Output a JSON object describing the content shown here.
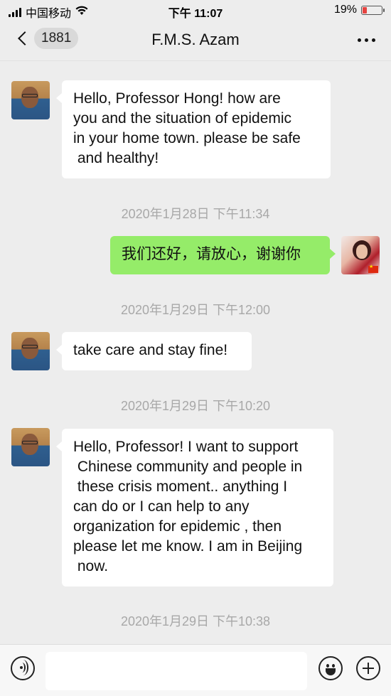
{
  "status_bar": {
    "carrier": "中国移动",
    "time": "下午 11:07",
    "battery_percent": "19%",
    "battery_level": 0.19,
    "battery_color": "#e64340"
  },
  "header": {
    "unread_count": "1881",
    "title": "F.M.S. Azam",
    "more_icon": "more-dots-icon"
  },
  "messages": [
    {
      "direction": "incoming",
      "text": "Hello, Professor Hong! how are\nyou and the situation of epidemic\nin your home town. please be safe\n and healthy!"
    },
    {
      "timestamp": "2020年1月28日 下午11:34"
    },
    {
      "direction": "outgoing",
      "text": "我们还好，请放心，谢谢你"
    },
    {
      "timestamp": "2020年1月29日 下午12:00"
    },
    {
      "direction": "incoming",
      "text": "take care and stay fine!"
    },
    {
      "timestamp": "2020年1月29日 下午10:20"
    },
    {
      "direction": "incoming",
      "text": "Hello, Professor! I want to support\n Chinese community and people in\n these crisis moment.. anything I\ncan do or I can help to any\norganization for epidemic , then\nplease let me know. I am in Beijing\n now."
    },
    {
      "timestamp": "2020年1月29日 下午10:38"
    }
  ],
  "input_bar": {
    "placeholder": "",
    "icons": [
      "voice-icon",
      "emoji-icon",
      "plus-icon"
    ]
  },
  "colors": {
    "background": "#ededed",
    "outgoing_bubble": "#95ec69",
    "incoming_bubble": "#ffffff",
    "timestamp_text": "#a8a8a8"
  }
}
